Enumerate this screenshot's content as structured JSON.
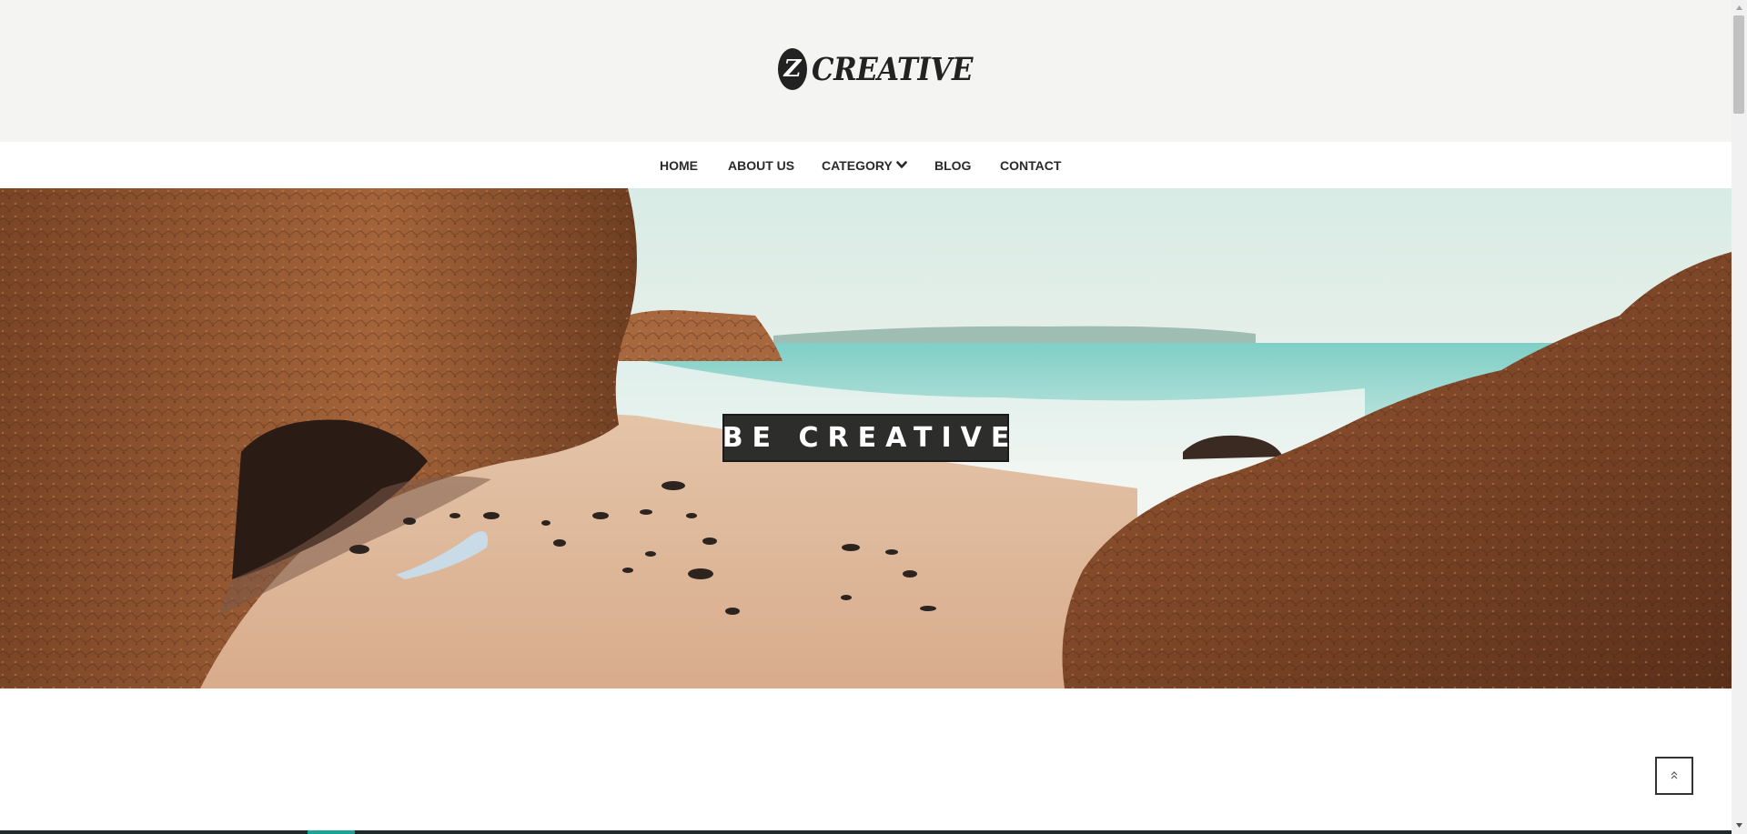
{
  "header": {
    "logo_mark": "Z",
    "logo_text": "CREATIVE"
  },
  "nav": {
    "items": [
      {
        "label": "HOME"
      },
      {
        "label": "ABOUT US"
      },
      {
        "label": "CATEGORY"
      },
      {
        "label": "BLOG"
      },
      {
        "label": "CONTACT"
      }
    ],
    "dropdown_icon": "chevron-down-icon"
  },
  "hero": {
    "banner_text": "BE CREATIVE",
    "image_description_icon": "beach-rocks-photo"
  },
  "back_to_top": {
    "icon": "double-chevron-up-icon",
    "glyph": "«"
  },
  "colors": {
    "header_bg": "#f4f4f2",
    "nav_bg": "#ffffff",
    "banner_bg": "#2d2d2b",
    "text_dark": "#2a2a2a",
    "footer_dark": "#1f2b2b",
    "footer_accent": "#1aa396"
  }
}
